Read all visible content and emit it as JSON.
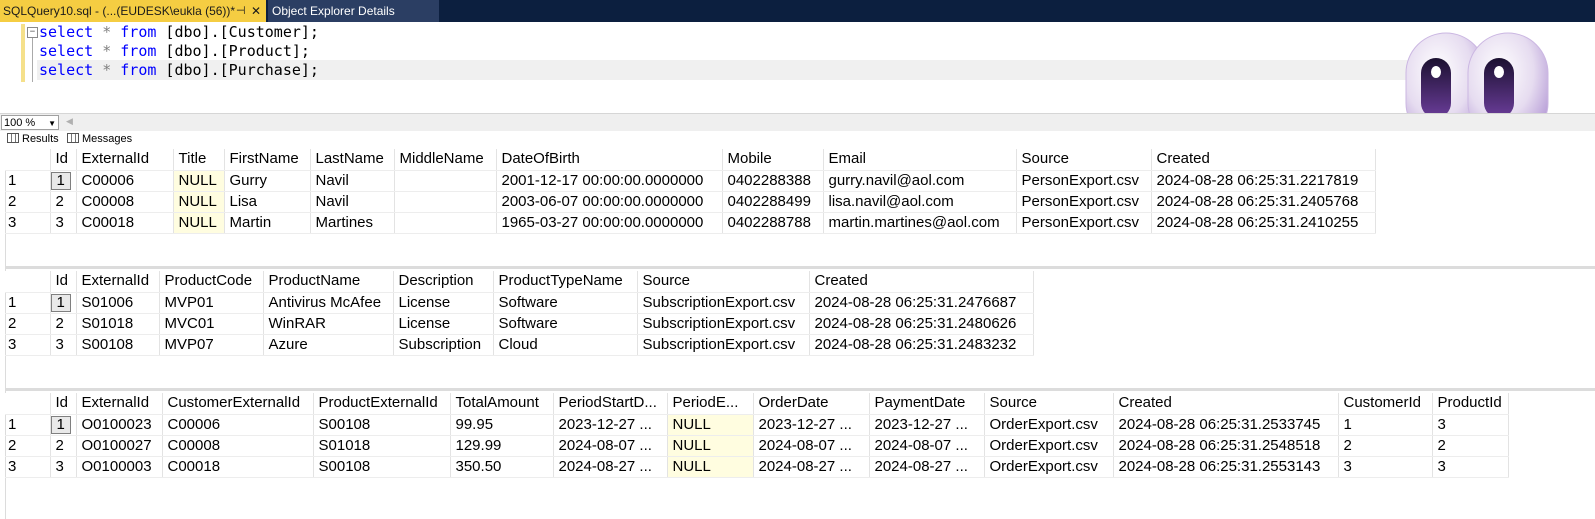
{
  "tabs": {
    "active_title": "SQLQuery10.sql - (...(EUDESK\\eukla (56))*",
    "inactive_title": "Object Explorer Details"
  },
  "editor": {
    "lines": [
      {
        "kw": "select",
        "star": " * ",
        "from": "from",
        "obj": " [dbo].[Customer];"
      },
      {
        "kw": "select",
        "star": " * ",
        "from": "from",
        "obj": " [dbo].[Product];"
      },
      {
        "kw": "select",
        "star": " * ",
        "from": "from",
        "obj": " [dbo].[Purchase];"
      }
    ]
  },
  "zoom": "100 %",
  "result_tabs": {
    "results": "Results",
    "messages": "Messages"
  },
  "customer": {
    "columns": [
      "",
      "Id",
      "ExternalId",
      "Title",
      "FirstName",
      "LastName",
      "MiddleName",
      "DateOfBirth",
      "Mobile",
      "Email",
      "Source",
      "Created"
    ],
    "rows": [
      [
        "1",
        "1",
        "C00006",
        "NULL",
        "Gurry",
        "Navil",
        "",
        "2001-12-17 00:00:00.0000000",
        "0402288388",
        "gurry.navil@aol.com",
        "PersonExport.csv",
        "2024-08-28 06:25:31.2217819"
      ],
      [
        "2",
        "2",
        "C00008",
        "NULL",
        "Lisa",
        "Navil",
        "",
        "2003-06-07 00:00:00.0000000",
        "0402288499",
        "lisa.navil@aol.com",
        "PersonExport.csv",
        "2024-08-28 06:25:31.2405768"
      ],
      [
        "3",
        "3",
        "C00018",
        "NULL",
        "Martin",
        "Martines",
        "",
        "1965-03-27 00:00:00.0000000",
        "0402288788",
        "martin.martines@aol.com",
        "PersonExport.csv",
        "2024-08-28 06:25:31.2410255"
      ]
    ]
  },
  "product": {
    "columns": [
      "",
      "Id",
      "ExternalId",
      "ProductCode",
      "ProductName",
      "Description",
      "ProductTypeName",
      "Source",
      "Created"
    ],
    "rows": [
      [
        "1",
        "1",
        "S01006",
        "MVP01",
        "Antivirus McAfee",
        "License",
        "Software",
        "SubscriptionExport.csv",
        "2024-08-28 06:25:31.2476687"
      ],
      [
        "2",
        "2",
        "S01018",
        "MVC01",
        "WinRAR",
        "License",
        "Software",
        "SubscriptionExport.csv",
        "2024-08-28 06:25:31.2480626"
      ],
      [
        "3",
        "3",
        "S00108",
        "MVP07",
        "Azure",
        "Subscription",
        "Cloud",
        "SubscriptionExport.csv",
        "2024-08-28 06:25:31.2483232"
      ]
    ]
  },
  "purchase": {
    "columns": [
      "",
      "Id",
      "ExternalId",
      "CustomerExternalId",
      "ProductExternalId",
      "TotalAmount",
      "PeriodStartD...",
      "PeriodE...",
      "OrderDate",
      "PaymentDate",
      "Source",
      "Created",
      "CustomerId",
      "ProductId"
    ],
    "rows": [
      [
        "1",
        "1",
        "O0100023",
        "C00006",
        "S00108",
        "99.95",
        "2023-12-27 ...",
        "NULL",
        "2023-12-27 ...",
        "2023-12-27 ...",
        "OrderExport.csv",
        "2024-08-28 06:25:31.2533745",
        "1",
        "3"
      ],
      [
        "2",
        "2",
        "O0100027",
        "C00008",
        "S01018",
        "129.99",
        "2024-08-07 ...",
        "NULL",
        "2024-08-07 ...",
        "2024-08-07 ...",
        "OrderExport.csv",
        "2024-08-28 06:25:31.2548518",
        "2",
        "2"
      ],
      [
        "3",
        "3",
        "O0100003",
        "C00018",
        "S00108",
        "350.50",
        "2024-08-27 ...",
        "NULL",
        "2024-08-27 ...",
        "2024-08-27 ...",
        "OrderExport.csv",
        "2024-08-28 06:25:31.2553143",
        "3",
        "3"
      ]
    ]
  },
  "colors": {
    "tab_active": "#f5cd42",
    "tab_strip": "#0c1f3f",
    "keyword": "#0000ff",
    "null_cell": "#fffde0"
  },
  "icons": {
    "pin": "pin-icon",
    "close": "close-icon",
    "results": "grid-icon",
    "messages": "messages-icon",
    "logo": "copilot-logo"
  }
}
